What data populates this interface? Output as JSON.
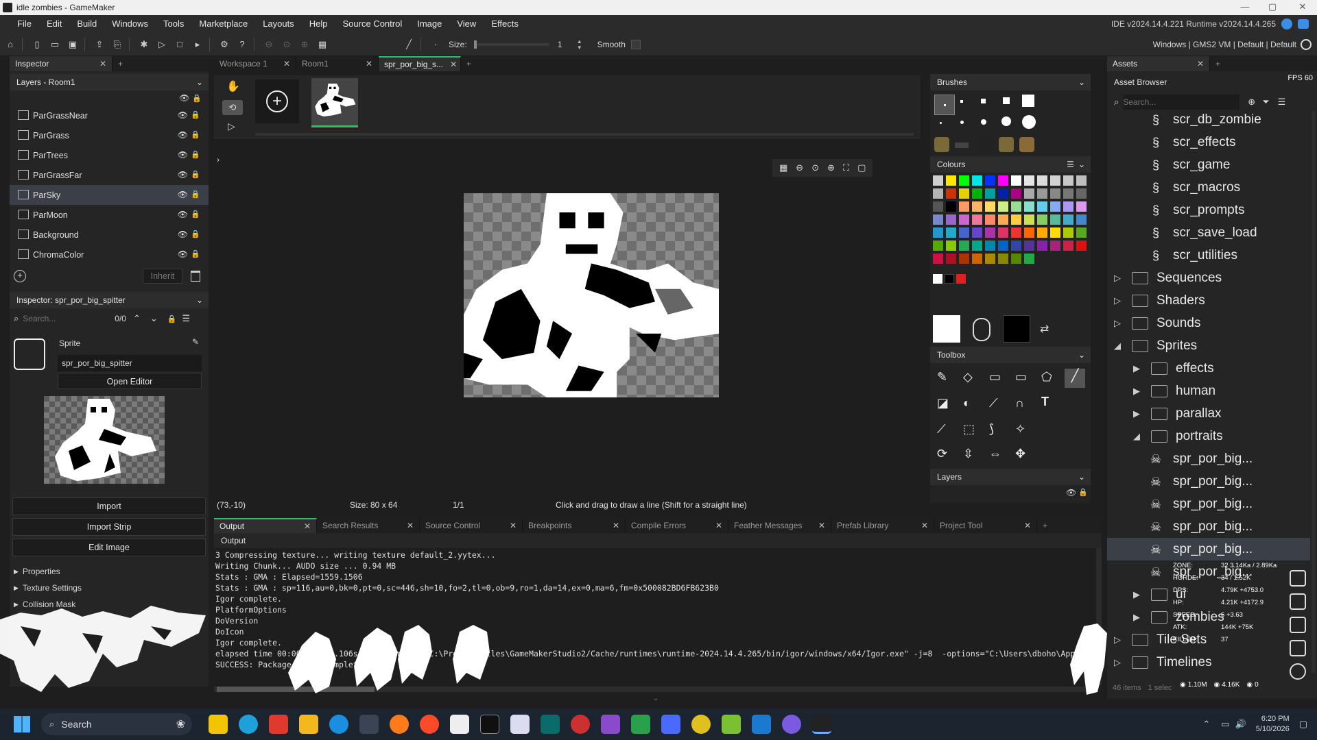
{
  "window": {
    "title": "idle zombies - GameMaker",
    "min": "—",
    "max": "▢",
    "close": "✕"
  },
  "menu": {
    "items": [
      "File",
      "Edit",
      "Build",
      "Windows",
      "Tools",
      "Marketplace",
      "Layouts",
      "Help",
      "Source Control",
      "Image",
      "View",
      "Effects"
    ],
    "ide_version": "IDE v2024.14.4.221  Runtime v2024.14.4.265"
  },
  "toolbar": {
    "size_label": "Size:",
    "size_value": "1",
    "smooth_label": "Smooth",
    "targets": "Windows | GMS2 VM | Default | Default"
  },
  "inspector": {
    "tab": "Inspector",
    "layers_header": "Layers - Room1",
    "layers": [
      "ParGrassNear",
      "ParGrass",
      "ParTrees",
      "ParGrassFar",
      "ParSky",
      "ParMoon",
      "Background",
      "ChromaColor"
    ],
    "selected_layer": "ParSky",
    "inherit_label": "Inherit",
    "sprite_inspector_header": "Inspector: spr_por_big_spitter",
    "search_placeholder": "Search...",
    "search_count": "0/0",
    "sprite_label": "Sprite",
    "sprite_name": "spr_por_big_spitter",
    "open_editor": "Open Editor",
    "import": "Import",
    "import_strip": "Import Strip",
    "edit_image": "Edit Image",
    "sections": [
      "Properties",
      "Texture Settings",
      "Collision Mask"
    ]
  },
  "editor": {
    "tabs": [
      {
        "label": "Workspace 1",
        "active": false
      },
      {
        "label": "Room1",
        "active": false
      },
      {
        "label": "spr_por_big_s...",
        "active": true
      }
    ],
    "status": {
      "coords": "(73,-10)",
      "size": "Size: 80 x 64",
      "frame": "1/1",
      "hint": "Click and drag to draw a line (Shift for a straight line)"
    }
  },
  "brushes": {
    "header": "Brushes",
    "colours_header": "Colours",
    "toolbox_header": "Toolbox",
    "layers_header": "Layers"
  },
  "palette": [
    "#d0d0d0",
    "#ffe600",
    "#00ff00",
    "#00e5e5",
    "#0033ff",
    "#ff00ff",
    "#ffffff",
    "#e6e6e6",
    "#dcdcdc",
    "#d2d2d2",
    "#c8c8c8",
    "#bebebe",
    "#b4b4b4",
    "#cc3300",
    "#e6d000",
    "#00b300",
    "#00a0a0",
    "#0022aa",
    "#aa0088",
    "#aaaaaa",
    "#999999",
    "#888888",
    "#777777",
    "#666666",
    "#555555",
    "#000000",
    "#ff9966",
    "#ffb366",
    "#ffd966",
    "#ccee88",
    "#99dd99",
    "#88ddcc",
    "#66ccee",
    "#88aaee",
    "#aa99ee",
    "#dd99ee",
    "#7788cc",
    "#9966cc",
    "#cc66cc",
    "#ee7799",
    "#ff8866",
    "#ffaa55",
    "#ffcc44",
    "#cce055",
    "#88cc66",
    "#55bb99",
    "#44aacc",
    "#4488cc",
    "#2299cc",
    "#22aacc",
    "#4466cc",
    "#6644cc",
    "#aa33aa",
    "#dd3366",
    "#ee3333",
    "#ff6600",
    "#ffaa00",
    "#ffdd00",
    "#aacc00",
    "#55aa22",
    "#55aa00",
    "#88cc00",
    "#22aa55",
    "#00aa88",
    "#0088aa",
    "#0066cc",
    "#3344aa",
    "#553399",
    "#8822aa",
    "#aa2277",
    "#cc2244",
    "#dd1111",
    "#cc1144",
    "#aa1122",
    "#aa3300",
    "#cc6600",
    "#aa8800",
    "#888800",
    "#558800",
    "#22aa44"
  ],
  "assets": {
    "tab": "Assets",
    "header": "Asset Browser",
    "fps": "FPS 60",
    "search_placeholder": "Search...",
    "items": [
      {
        "label": "scr_db_zombie",
        "kind": "script",
        "depth": 2
      },
      {
        "label": "scr_effects",
        "kind": "script",
        "depth": 2
      },
      {
        "label": "scr_game",
        "kind": "script",
        "depth": 2
      },
      {
        "label": "scr_macros",
        "kind": "script",
        "depth": 2
      },
      {
        "label": "scr_prompts",
        "kind": "script",
        "depth": 2
      },
      {
        "label": "scr_save_load",
        "kind": "script",
        "depth": 2
      },
      {
        "label": "scr_utilities",
        "kind": "script",
        "depth": 2
      },
      {
        "label": "Sequences",
        "kind": "folder",
        "depth": 0,
        "arrow": "▷"
      },
      {
        "label": "Shaders",
        "kind": "folder",
        "depth": 0,
        "arrow": "▷"
      },
      {
        "label": "Sounds",
        "kind": "folder",
        "depth": 0,
        "arrow": "▷"
      },
      {
        "label": "Sprites",
        "kind": "folder",
        "depth": 0,
        "arrow": "◢"
      },
      {
        "label": "effects",
        "kind": "folder",
        "depth": 1,
        "arrow": "▶"
      },
      {
        "label": "human",
        "kind": "folder",
        "depth": 1,
        "arrow": "▶"
      },
      {
        "label": "parallax",
        "kind": "folder",
        "depth": 1,
        "arrow": "▶"
      },
      {
        "label": "portraits",
        "kind": "folder",
        "depth": 1,
        "arrow": "◢"
      },
      {
        "label": "spr_por_big...",
        "kind": "sprite",
        "depth": 2
      },
      {
        "label": "spr_por_big...",
        "kind": "sprite",
        "depth": 2
      },
      {
        "label": "spr_por_big...",
        "kind": "sprite",
        "depth": 2
      },
      {
        "label": "spr_por_big...",
        "kind": "sprite",
        "depth": 2
      },
      {
        "label": "spr_por_big...",
        "kind": "sprite",
        "depth": 2,
        "selected": true
      },
      {
        "label": "spr_por_big...",
        "kind": "sprite",
        "depth": 2
      },
      {
        "label": "ui",
        "kind": "folder",
        "depth": 1,
        "arrow": "▶"
      },
      {
        "label": "zombies",
        "kind": "folder",
        "depth": 1,
        "arrow": "▶"
      },
      {
        "label": "Tile Sets",
        "kind": "folder",
        "depth": 0,
        "arrow": "▷"
      },
      {
        "label": "Timelines",
        "kind": "folder",
        "depth": 0,
        "arrow": "▷"
      }
    ],
    "footer_count": "46 items",
    "footer_sel": "1 selec",
    "overlay": {
      "stats": [
        {
          "k": "ZONE:",
          "v": "32 3.14Ka / 2.89Ka"
        },
        {
          "k": "HORDE:",
          "v": "34 / 1.52K"
        },
        {
          "k": "DPS:",
          "v": "4.79K +4753.0"
        },
        {
          "k": "HP:",
          "v": "4.21K +4172.9"
        },
        {
          "k": "SPEED:",
          "v": "6 +3.63"
        },
        {
          "k": "ATK:",
          "v": "144K +75K"
        },
        {
          "k": "KILLED:",
          "v": "37"
        }
      ],
      "currency": [
        "1.10M",
        "4.16K",
        "0"
      ]
    }
  },
  "output": {
    "tabs": [
      "Output",
      "Search Results",
      "Source Control",
      "Breakpoints",
      "Compile Errors",
      "Feather Messages",
      "Prefab Library",
      "Project Tool"
    ],
    "header": "Output",
    "lines": [
      "3 Compressing texture... writing texture default_2.yytex...",
      "Writing Chunk... AUDO size ... 0.94 MB",
      "Stats : GMA : Elapsed=1559.1506",
      "Stats : GMA : sp=116,au=0,bk=0,pt=0,sc=446,sh=10,fo=2,tl=0,ob=9,ro=1,da=14,ex=0,ma=6,fm=0x500082BD6FB623B0",
      "Igor complete.",
      "PlatformOptions",
      "DoVersion",
      "DoIcon",
      "Igor complete.",
      "elapsed time 00:00:06  ...106s  for command \"C:\\Program Files\\GameMakerStudio2/Cache/runtimes\\runtime-2024.14.4.265/bin/igor/windows/x64/Igor.exe\" -j=8  -options=\"C:\\Users\\dboho\\AppD",
      "SUCCESS: Package  ...  Complete"
    ]
  },
  "taskbar": {
    "search": "Search",
    "time": "6:20 PM",
    "date": "5/10/2026"
  }
}
